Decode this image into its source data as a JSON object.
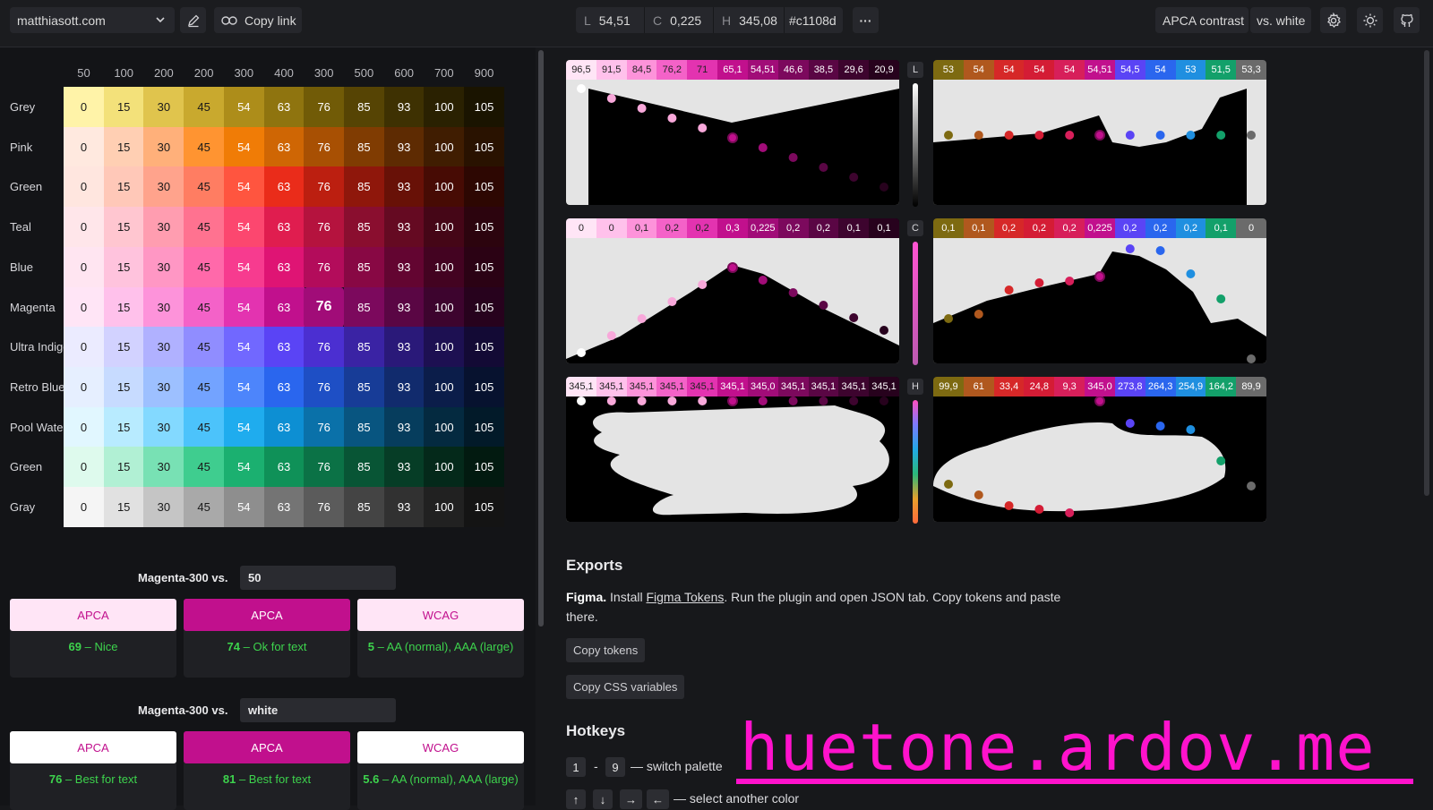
{
  "topbar": {
    "site": "matthiasott.com",
    "copy_link": "Copy link",
    "lch": {
      "l_key": "L",
      "l_val": "54,51",
      "c_key": "C",
      "c_val": "0,225",
      "h_key": "H",
      "h_val": "345,08",
      "hex": "#c1108d"
    },
    "more": "···",
    "contrast_mode": "APCA contrast",
    "vs_mode": "vs. white"
  },
  "grid": {
    "columns": [
      "50",
      "100",
      "200",
      "200",
      "300",
      "400",
      "300",
      "500",
      "600",
      "700",
      "900"
    ],
    "rows": [
      {
        "label": "Grey",
        "colors": [
          "#fff3a8",
          "#f3e17a",
          "#e0c44d",
          "#c9a92e",
          "#ad8d1a",
          "#8f740f",
          "#715b07",
          "#564404",
          "#3e3102",
          "#2a2101",
          "#1a1400"
        ]
      },
      {
        "label": "Pink",
        "colors": [
          "#ffe9df",
          "#ffcfb3",
          "#ffb07a",
          "#ff9431",
          "#f07c06",
          "#cf6604",
          "#a85003",
          "#803c02",
          "#5e2b02",
          "#401d01",
          "#291200"
        ]
      },
      {
        "label": "Green",
        "colors": [
          "#ffe6df",
          "#ffc8b8",
          "#ffa38c",
          "#ff7d62",
          "#ff553f",
          "#ea2c1a",
          "#bc1f10",
          "#8f170b",
          "#681107",
          "#470b04",
          "#2d0702"
        ]
      },
      {
        "label": "Teal",
        "colors": [
          "#ffe6ea",
          "#ffc6d0",
          "#ff9db0",
          "#ff7290",
          "#fc476f",
          "#e01d4f",
          "#b5133e",
          "#8a0e2f",
          "#650a22",
          "#450617",
          "#2c040e"
        ]
      },
      {
        "label": "Blue",
        "colors": [
          "#ffe5f1",
          "#ffc3dd",
          "#ff97c4",
          "#ff69aa",
          "#f73b8f",
          "#df1474",
          "#b30c5b",
          "#880844",
          "#630531",
          "#430321",
          "#2b0214"
        ]
      },
      {
        "label": "Magenta",
        "colors": [
          "#ffe5f6",
          "#ffc1eb",
          "#fd93da",
          "#f462c8",
          "#e333b0",
          "#c1108d",
          "#a10c78",
          "#7c095d",
          "#5a0644",
          "#3d042e",
          "#27021d"
        ]
      },
      {
        "label": "Ultra Indigo",
        "colors": [
          "#ebebff",
          "#d2d2ff",
          "#b0b1ff",
          "#908dff",
          "#7168ff",
          "#5a44f5",
          "#4b2fd1",
          "#3a23a4",
          "#2a1979",
          "#1d1052",
          "#130a35"
        ]
      },
      {
        "label": "Retro Blue",
        "colors": [
          "#e6efff",
          "#c7dbff",
          "#9dc0ff",
          "#73a3ff",
          "#4d85fb",
          "#2a66ee",
          "#1e4fc5",
          "#173c97",
          "#112b6d",
          "#0b1d4a",
          "#07122f"
        ]
      },
      {
        "label": "Pool Water",
        "colors": [
          "#e1f7ff",
          "#b8ebff",
          "#83d9ff",
          "#4cc3fb",
          "#1facee",
          "#0d8fd3",
          "#0a71a9",
          "#085580",
          "#063d5d",
          "#042a40",
          "#021a29"
        ]
      },
      {
        "label": "Green",
        "colors": [
          "#defaed",
          "#b1f0d4",
          "#78e1b4",
          "#3fcd8f",
          "#1bb070",
          "#0f9158",
          "#0b7246",
          "#085535",
          "#063d26",
          "#04291a",
          "#021a10"
        ]
      },
      {
        "label": "Gray",
        "colors": [
          "#f5f5f5",
          "#e1e1e1",
          "#c5c5c5",
          "#a9a9a9",
          "#8e8e8e",
          "#747474",
          "#5b5b5b",
          "#444444",
          "#313131",
          "#212121",
          "#141414"
        ]
      }
    ],
    "values": [
      "0",
      "15",
      "30",
      "45",
      "54",
      "63",
      "76",
      "85",
      "93",
      "100",
      "105"
    ],
    "selected": {
      "row": 5,
      "col": 6
    }
  },
  "compare_50": {
    "label": "Magenta-300 vs.",
    "value": "50",
    "cards": [
      {
        "btn": "APCA",
        "num": "69",
        "text": "– Nice",
        "style": "light"
      },
      {
        "btn": "APCA",
        "num": "74",
        "text": "– Ok for text",
        "style": "filled"
      },
      {
        "btn": "WCAG",
        "num": "5",
        "text": "– AA (normal), AAA (large)",
        "style": "light"
      }
    ]
  },
  "compare_white": {
    "label": "Magenta-300 vs.",
    "value": "white",
    "cards": [
      {
        "btn": "APCA",
        "num": "76",
        "text": "– Best for text",
        "style": "white"
      },
      {
        "btn": "APCA",
        "num": "81",
        "text": "– Best for text",
        "style": "filled"
      },
      {
        "btn": "WCAG",
        "num": "5.6",
        "text": "– AA (normal), AAA (large)",
        "style": "white"
      }
    ]
  },
  "charts": {
    "axis_tags": [
      "L",
      "C",
      "H"
    ],
    "l_left": [
      "96,5",
      "91,5",
      "84,5",
      "76,2",
      "71",
      "65,1",
      "54,51",
      "46,6",
      "38,5",
      "29,6",
      "20,9"
    ],
    "l_right": [
      "53",
      "54",
      "54",
      "54",
      "54",
      "54,51",
      "54,5",
      "54",
      "53",
      "51,5",
      "53,3"
    ],
    "c_left": [
      "0",
      "0",
      "0,1",
      "0,2",
      "0,2",
      "0,3",
      "0,225",
      "0,2",
      "0,2",
      "0,1",
      "0,1"
    ],
    "c_right": [
      "0,1",
      "0,1",
      "0,2",
      "0,2",
      "0,2",
      "0,225",
      "0,2",
      "0,2",
      "0,2",
      "0,1",
      "0"
    ],
    "h_left": [
      "345,1",
      "345,1",
      "345,1",
      "345,1",
      "345,1",
      "345,1",
      "345,0",
      "345,1",
      "345,1",
      "345,1",
      "345,1"
    ],
    "h_right": [
      "99,9",
      "61",
      "33,4",
      "24,8",
      "9,3",
      "345,0",
      "273,8",
      "264,3",
      "254,9",
      "164,2",
      "89,9"
    ],
    "right_colors": [
      "#7d6a11",
      "#b0581e",
      "#d62828",
      "#d41c35",
      "#d71f5a",
      "#c1108d",
      "#5a44f5",
      "#2a66ee",
      "#1f8fe0",
      "#13a06a",
      "#6b6b6b"
    ]
  },
  "exports": {
    "title": "Exports",
    "figma_bold": "Figma.",
    "text1": "Install",
    "link": "Figma Tokens",
    "text2": ". Run the plugin and open JSON tab. Copy tokens and paste there.",
    "copy_tokens": "Copy tokens",
    "copy_css": "Copy CSS variables"
  },
  "hotkeys": {
    "title": "Hotkeys",
    "k1": "1",
    "dash": "-",
    "k9": "9",
    "switch": "— switch palette",
    "up": "↑",
    "down": "↓",
    "right": "→",
    "left": "←",
    "select": "— select another color"
  },
  "watermark": "huetone.ardov.me"
}
